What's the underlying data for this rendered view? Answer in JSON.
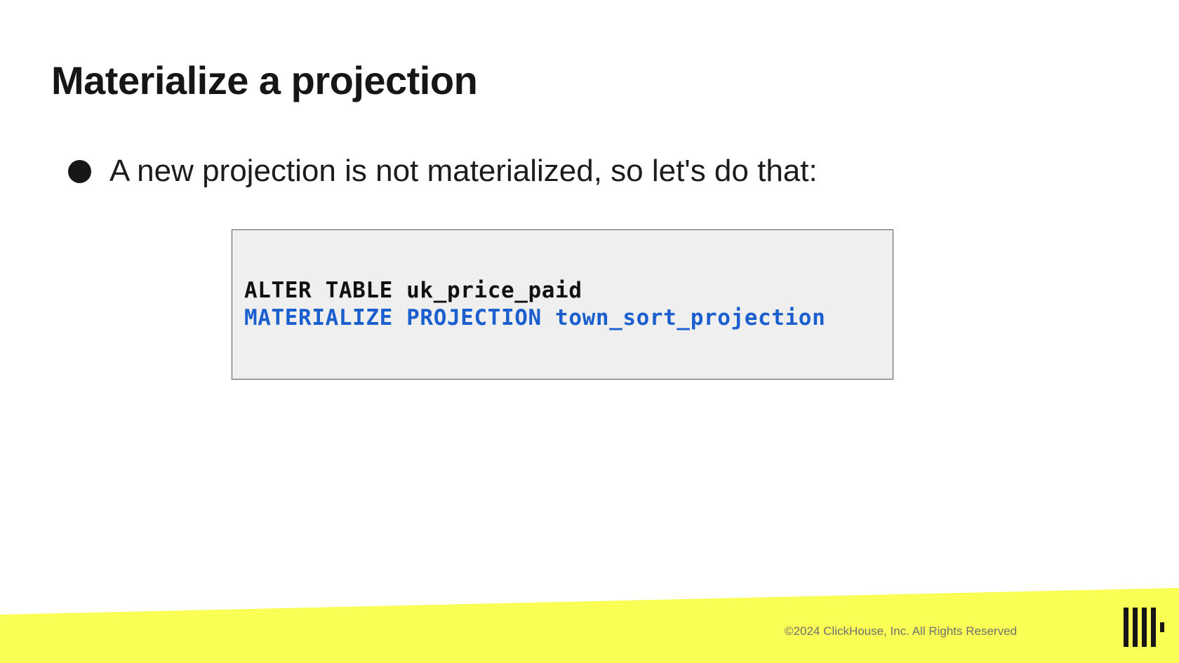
{
  "slide": {
    "title": "Materialize a projection",
    "bullets": [
      {
        "text": "A new projection is not materialized, so let's do that:"
      }
    ],
    "code": {
      "lines": [
        {
          "text": "ALTER TABLE uk_price_paid",
          "color": "#111111"
        },
        {
          "text": "MATERIALIZE PROJECTION town_sort_projection",
          "color": "#1b5fcf"
        }
      ]
    }
  },
  "footer": {
    "copyright": "©2024 ClickHouse, Inc. All Rights Reserved",
    "band_color": "#faff55",
    "logo": "clickhouse-logo-icon"
  }
}
